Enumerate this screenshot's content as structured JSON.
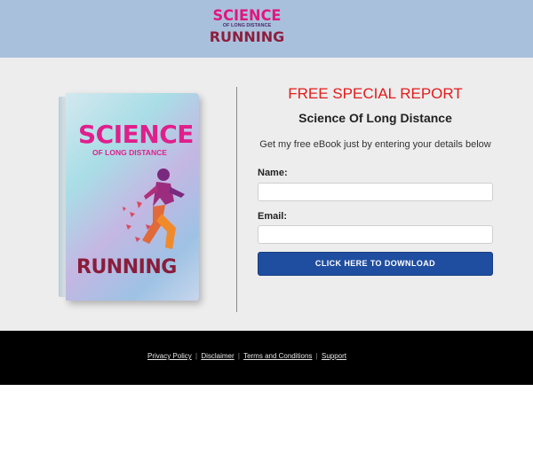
{
  "header": {
    "logo": {
      "top": "SCIENCE",
      "mid": "OF LONG DISTANCE",
      "bottom": "RUNNING"
    }
  },
  "book": {
    "title": "SCIENCE",
    "subtitle": "OF LONG DISTANCE",
    "bottom": "RUNNING"
  },
  "optin": {
    "headline": "FREE SPECIAL REPORT",
    "subhead": "Science Of Long Distance",
    "description": "Get my free eBook just by entering your details below",
    "name_label": "Name:",
    "name_value": "",
    "email_label": "Email:",
    "email_value": "",
    "cta_label": "CLICK HERE TO DOWNLOAD"
  },
  "footer": {
    "links": [
      "Privacy Policy",
      "Disclaimer",
      "Terms and Conditions",
      "Support"
    ],
    "separator": "|"
  },
  "colors": {
    "header_bg": "#a9c0dd",
    "main_bg": "#ededed",
    "headline": "#e21b1b",
    "cta_bg": "#1f4ea0",
    "footer_bg": "#000000"
  }
}
